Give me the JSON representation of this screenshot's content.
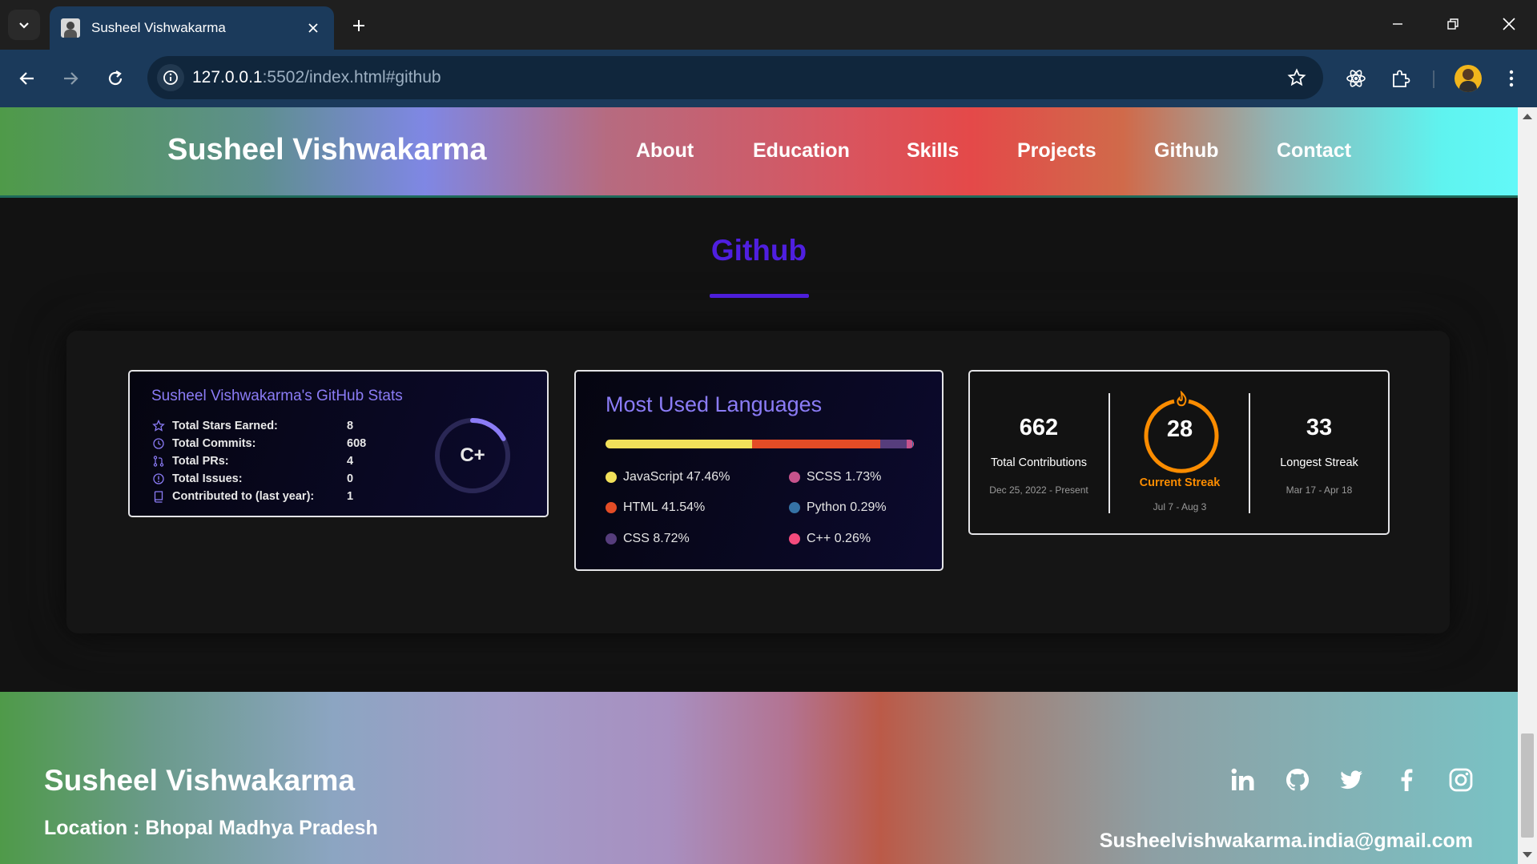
{
  "browser": {
    "tab_title": "Susheel Vishwakarma",
    "url_host": "127.0.0.1",
    "url_rest": ":5502/index.html#github"
  },
  "header": {
    "brand": "Susheel Vishwakarma",
    "nav": [
      "About",
      "Education",
      "Skills",
      "Projects",
      "Github",
      "Contact"
    ]
  },
  "section": {
    "title": "Github"
  },
  "stats_card": {
    "title": "Susheel Vishwakarma's GitHub Stats",
    "rows": [
      {
        "label": "Total Stars Earned:",
        "value": "8",
        "icon": "star-icon"
      },
      {
        "label": "Total Commits:",
        "value": "608",
        "icon": "history-icon"
      },
      {
        "label": "Total PRs:",
        "value": "4",
        "icon": "pull-request-icon"
      },
      {
        "label": "Total Issues:",
        "value": "0",
        "icon": "issue-icon"
      },
      {
        "label": "Contributed to (last year):",
        "value": "1",
        "icon": "repo-icon"
      }
    ],
    "rank": "C+",
    "rank_progress": 0.17,
    "accent": "#8b7cf6"
  },
  "languages_card": {
    "title": "Most Used Languages",
    "languages": [
      {
        "name": "JavaScript",
        "percent": "47.46%",
        "value": 47.46,
        "color": "#f1e05a"
      },
      {
        "name": "SCSS",
        "percent": "1.73%",
        "value": 1.73,
        "color": "#c6538c"
      },
      {
        "name": "HTML",
        "percent": "41.54%",
        "value": 41.54,
        "color": "#e34c26"
      },
      {
        "name": "Python",
        "percent": "0.29%",
        "value": 0.29,
        "color": "#3572a5"
      },
      {
        "name": "CSS",
        "percent": "8.72%",
        "value": 8.72,
        "color": "#563d7c"
      },
      {
        "name": "C++",
        "percent": "0.26%",
        "value": 0.26,
        "color": "#f34b7d"
      }
    ]
  },
  "streak_card": {
    "total_contributions": "662",
    "total_label": "Total Contributions",
    "total_range": "Dec 25, 2022 - Present",
    "current_streak": "28",
    "current_label": "Current Streak",
    "current_range": "Jul 7 - Aug 3",
    "longest_streak": "33",
    "longest_label": "Longest Streak",
    "longest_range": "Mar 17 - Apr 18",
    "accent": "#fb8c00"
  },
  "footer": {
    "name": "Susheel Vishwakarma",
    "location": "Location : Bhopal Madhya Pradesh",
    "email": "Susheelvishwakarma.india@gmail.com",
    "socials": [
      "linkedin-icon",
      "github-icon",
      "twitter-icon",
      "facebook-icon",
      "instagram-icon"
    ]
  }
}
